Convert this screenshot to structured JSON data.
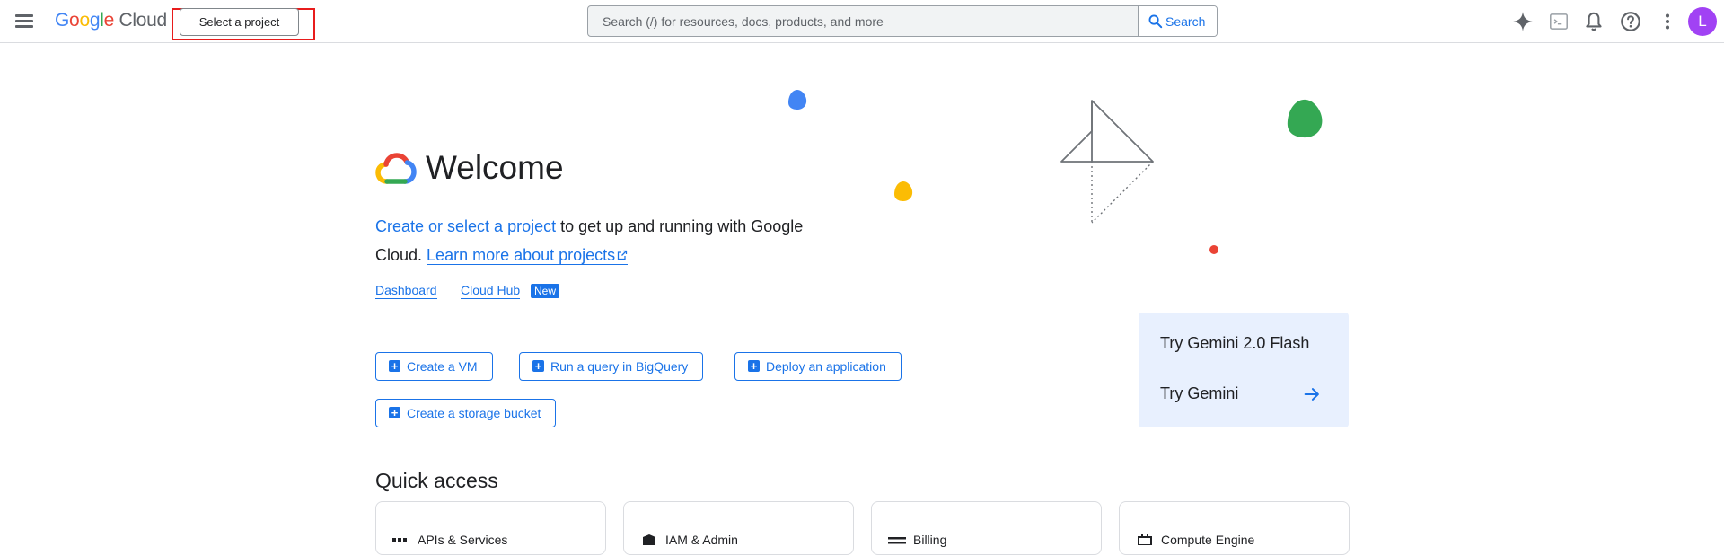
{
  "header": {
    "logo": {
      "google": "Google",
      "cloud": "Cloud"
    },
    "project_picker": "Select a project",
    "search": {
      "placeholder": "Search (/) for resources, docs, products, and more",
      "button": "Search"
    },
    "icons": [
      "menu-icon",
      "gemini-sparkle-icon",
      "cloud-shell-icon",
      "notifications-icon",
      "help-icon",
      "more-vert-icon"
    ],
    "avatar_letter": "L"
  },
  "welcome": {
    "title": "Welcome",
    "intro_link": "Create or select a project",
    "intro_text": " to get up and running with Google Cloud.",
    "learn_more": "Learn more about projects"
  },
  "quick_links": {
    "dashboard": "Dashboard",
    "cloud_hub": "Cloud Hub",
    "new_badge": "New"
  },
  "actions": [
    {
      "label": "Create a VM"
    },
    {
      "label": "Run a query in BigQuery"
    },
    {
      "label": "Deploy an application"
    },
    {
      "label": "Create a storage bucket"
    }
  ],
  "gemini": {
    "title": "Try Gemini 2.0 Flash",
    "link": "Try Gemini"
  },
  "quick_access": {
    "title": "Quick access",
    "cards": [
      {
        "label": "APIs & Services",
        "icon": "api-icon"
      },
      {
        "label": "IAM & Admin",
        "icon": "shield-icon"
      },
      {
        "label": "Billing",
        "icon": "billing-icon"
      },
      {
        "label": "Compute Engine",
        "icon": "compute-icon"
      }
    ]
  },
  "colors": {
    "accent": "#1a73e8",
    "highlight": "#e81c1c",
    "gemini_card": "#e8f0fe",
    "avatar": "#a142f4"
  }
}
